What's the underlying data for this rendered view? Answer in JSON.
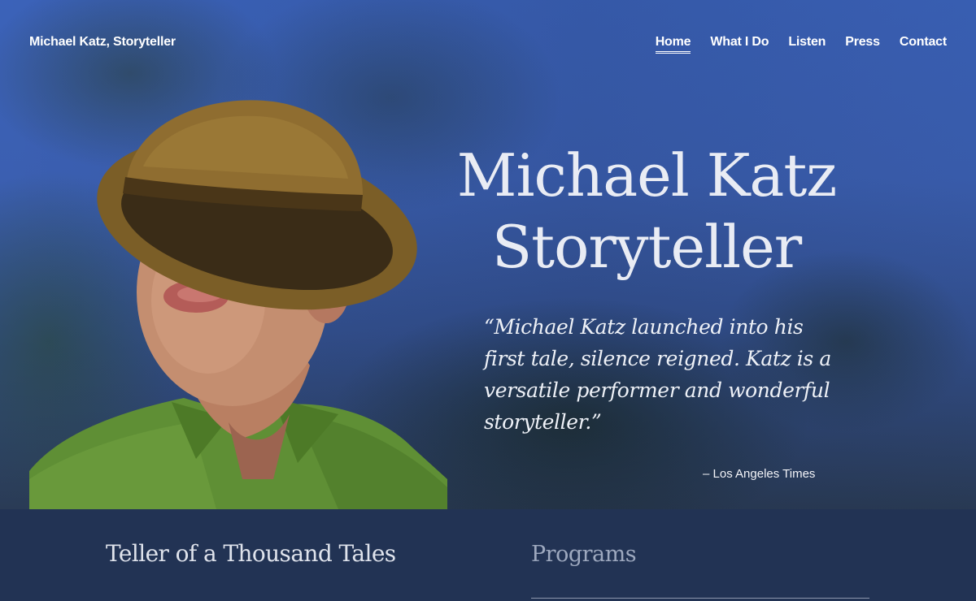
{
  "header": {
    "site_title": "Michael Katz, Storyteller",
    "nav": [
      {
        "label": "Home",
        "active": true
      },
      {
        "label": "What I Do",
        "active": false
      },
      {
        "label": "Listen",
        "active": false
      },
      {
        "label": "Press",
        "active": false
      },
      {
        "label": "Contact",
        "active": false
      }
    ]
  },
  "hero": {
    "headline_line1": "Michael Katz",
    "headline_line2": "Storyteller",
    "quote": "“Michael Katz launched into his first tale, silence reigned. Katz is a versatile performer and wonderful storyteller.”",
    "attribution": "– Los Angeles Times",
    "portrait": "photo of storyteller in brown hat and green shirt"
  },
  "sections": {
    "left_heading": "Teller of a Thousand Tales",
    "right_heading": "Programs"
  },
  "colors": {
    "sky_blue": "#3b62b9",
    "navy_band": "#223354",
    "hat_brown": "#8a6a2a",
    "shirt_green": "#5f8f35"
  }
}
